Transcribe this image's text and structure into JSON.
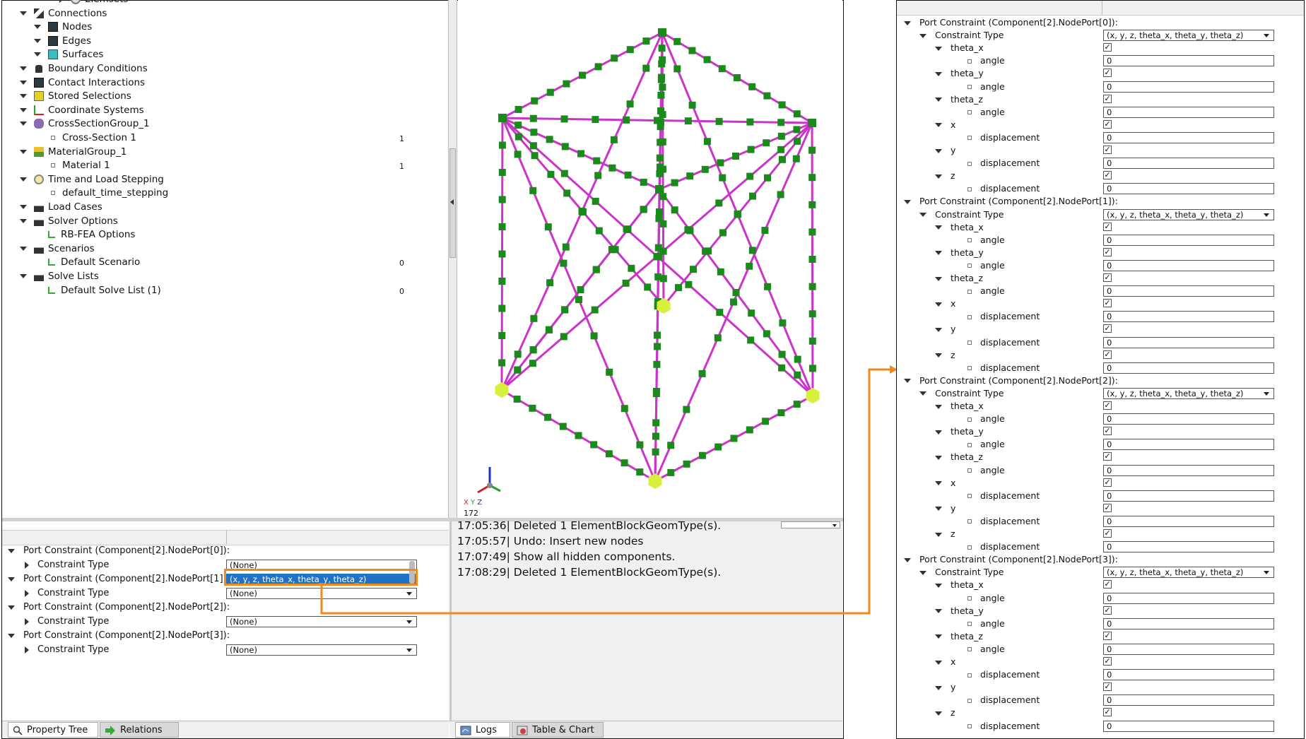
{
  "tree": {
    "items": [
      {
        "label": "Elemsets",
        "count": ""
      },
      {
        "label": "Connections",
        "count": ""
      },
      {
        "label": "Nodes",
        "count": ""
      },
      {
        "label": "Edges",
        "count": ""
      },
      {
        "label": "Surfaces",
        "count": ""
      },
      {
        "label": "Boundary Conditions",
        "count": ""
      },
      {
        "label": "Contact Interactions",
        "count": ""
      },
      {
        "label": "Stored Selections",
        "count": ""
      },
      {
        "label": "Coordinate Systems",
        "count": ""
      },
      {
        "label": "CrossSectionGroup_1",
        "count": ""
      },
      {
        "label": "Cross-Section 1",
        "count": "1"
      },
      {
        "label": "MaterialGroup_1",
        "count": ""
      },
      {
        "label": "Material 1",
        "count": "1"
      },
      {
        "label": "Time and Load Stepping",
        "count": ""
      },
      {
        "label": "default_time_stepping",
        "count": ""
      },
      {
        "label": "Load Cases",
        "count": ""
      },
      {
        "label": "Solver Options",
        "count": ""
      },
      {
        "label": "RB-FEA Options",
        "count": ""
      },
      {
        "label": "Scenarios",
        "count": ""
      },
      {
        "label": "Default Scenario",
        "count": "0"
      },
      {
        "label": "Solve Lists",
        "count": ""
      },
      {
        "label": "Default Solve List (1)",
        "count": "0"
      }
    ]
  },
  "viewport": {
    "axis_x": "X",
    "axis_y": "Y",
    "axis_z": "Z",
    "zoom_label": "172",
    "colors": {
      "beam": "#cc33cc",
      "node": "#1a8a1a",
      "port": "#d8f03c"
    }
  },
  "props": {
    "rows": [
      {
        "label": "Port Constraint (Component[2].NodePort[0]):",
        "value": ""
      },
      {
        "label": "Constraint Type",
        "value": "(None)"
      },
      {
        "label": "Port Constraint (Component[2].NodePort[1]):",
        "value": "(x, y, z, theta_x, theta_y, theta_z)"
      },
      {
        "label": "Constraint Type",
        "value": "(None)"
      },
      {
        "label": "Port Constraint (Component[2].NodePort[2]):",
        "value": ""
      },
      {
        "label": "Constraint Type",
        "value": "(None)"
      },
      {
        "label": "Port Constraint (Component[2].NodePort[3]):",
        "value": ""
      },
      {
        "label": "Constraint Type",
        "value": "(None)"
      }
    ],
    "tabs": {
      "property_tree": "Property Tree",
      "relations": "Relations"
    }
  },
  "logs": {
    "lines": [
      "17:05:36| Deleted 1 ElementBlockGeomType(s).",
      "17:05:57| Undo: Insert new nodes",
      "17:07:49| Show all hidden components.",
      "17:08:29| Deleted 1 ElementBlockGeomType(s)."
    ],
    "tabs": {
      "logs": "Logs",
      "table_chart": "Table & Chart"
    }
  },
  "right": {
    "ports": [
      {
        "header": "Port Constraint (Component[2].NodePort[0]):"
      },
      {
        "header": "Port Constraint (Component[2].NodePort[1]):"
      },
      {
        "header": "Port Constraint (Component[2].NodePort[2]):"
      },
      {
        "header": "Port Constraint (Component[2].NodePort[3]):"
      }
    ],
    "constraint_type_label": "Constraint Type",
    "constraint_type_value": "(x, y, z, theta_x, theta_y, theta_z)",
    "dofs": [
      {
        "name": "theta_x",
        "param": "angle",
        "checked": "✓",
        "value": "0"
      },
      {
        "name": "theta_y",
        "param": "angle",
        "checked": "✓",
        "value": "0"
      },
      {
        "name": "theta_z",
        "param": "angle",
        "checked": "✓",
        "value": "0"
      },
      {
        "name": "x",
        "param": "displacement",
        "checked": "✓",
        "value": "0"
      },
      {
        "name": "y",
        "param": "displacement",
        "checked": "✓",
        "value": "0"
      },
      {
        "name": "z",
        "param": "displacement",
        "checked": "✓",
        "value": "0"
      }
    ]
  },
  "accent_colors": {
    "highlight": "#f08a1c",
    "selection": "#1e73c8"
  }
}
